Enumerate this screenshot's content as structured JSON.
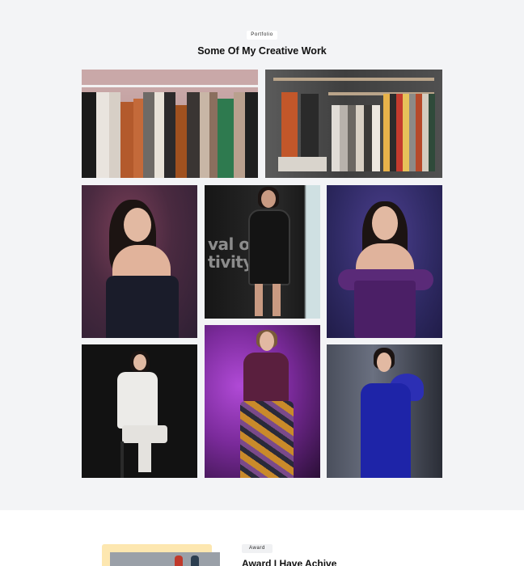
{
  "portfolio": {
    "badge": "Portfolio",
    "title": "Some Of My Creative Work",
    "background": "#f3f4f6",
    "photos": [
      {
        "alt": "clothes-rack"
      },
      {
        "alt": "wardrobe"
      },
      {
        "alt": "model-dark-floral-dress"
      },
      {
        "alt": "runway-model-sheer-black-dress"
      },
      {
        "alt": "model-purple-off-shoulder-dress"
      },
      {
        "alt": "model-white-suit"
      },
      {
        "alt": "runway-model-purple-top-printed-skirt"
      },
      {
        "alt": "model-blue-dress"
      }
    ],
    "runway_banner_text": "val of\ntivity"
  },
  "award": {
    "badge": "Award",
    "title": "Award I Have Achive",
    "frame_color": "#fde7b0"
  }
}
